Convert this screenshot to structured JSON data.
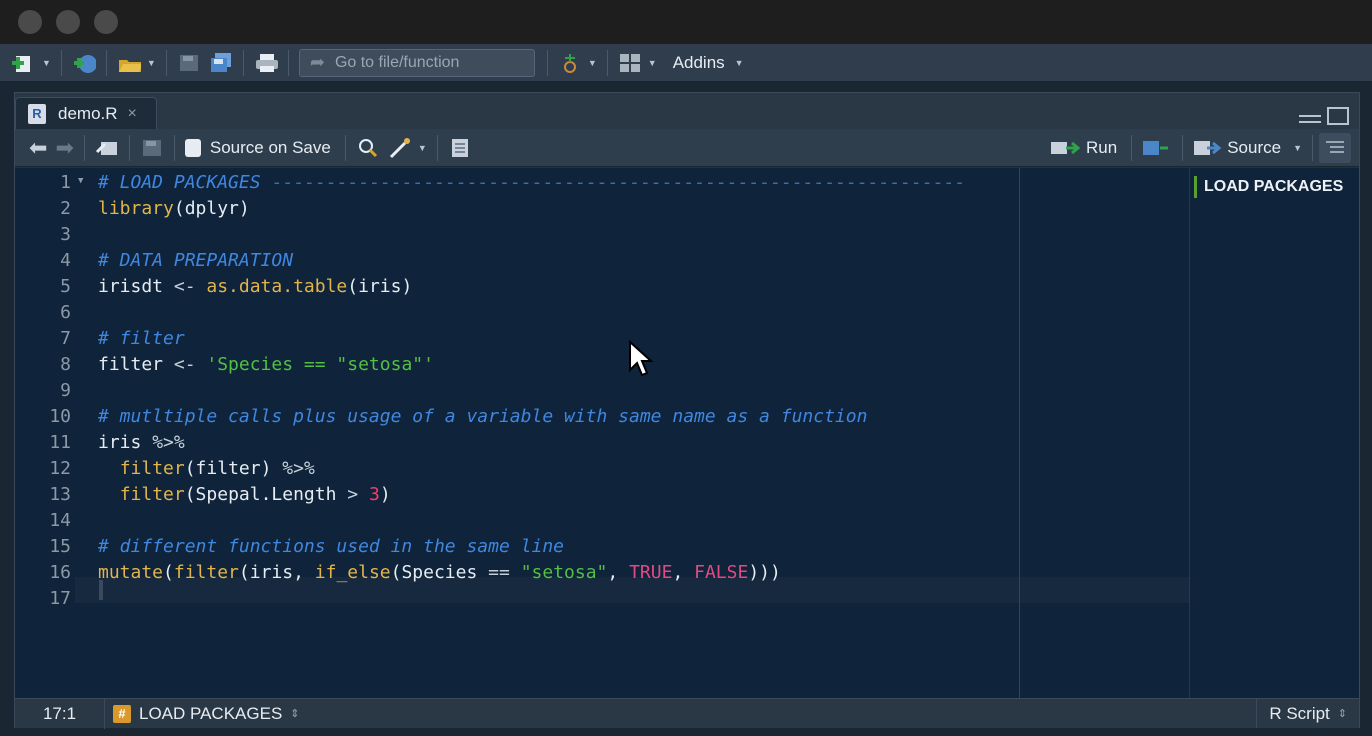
{
  "window": {
    "toolbar": {
      "goto_placeholder": "Go to file/function",
      "addins_label": "Addins"
    }
  },
  "tab": {
    "filename": "demo.R",
    "r_icon_letter": "R",
    "close_glyph": "×"
  },
  "editor_toolbar": {
    "source_on_save_label": "Source on Save",
    "run_label": "Run",
    "source_label": "Source"
  },
  "editor": {
    "line_numbers": [
      "1",
      "2",
      "3",
      "4",
      "5",
      "6",
      "7",
      "8",
      "9",
      "10",
      "11",
      "12",
      "13",
      "14",
      "15",
      "16",
      "17"
    ],
    "lines": [
      [
        {
          "t": "# LOAD PACKAGES ",
          "c": "c-com"
        },
        {
          "t": "----------------------------------------------------------------",
          "c": "c-dash"
        }
      ],
      [
        {
          "t": "library",
          "c": "c-fn"
        },
        {
          "t": "(dplyr)",
          "c": "c-id"
        }
      ],
      [],
      [
        {
          "t": "# DATA PREPARATION",
          "c": "c-com"
        }
      ],
      [
        {
          "t": "irisdt ",
          "c": "c-id"
        },
        {
          "t": "<- ",
          "c": "c-op"
        },
        {
          "t": "as.data.table",
          "c": "c-fn"
        },
        {
          "t": "(iris)",
          "c": "c-id"
        }
      ],
      [],
      [
        {
          "t": "# filter",
          "c": "c-com"
        }
      ],
      [
        {
          "t": "filter ",
          "c": "c-id"
        },
        {
          "t": "<- ",
          "c": "c-op"
        },
        {
          "t": "'Species == \"setosa\"'",
          "c": "c-str"
        }
      ],
      [],
      [
        {
          "t": "# mutltiple calls plus usage of a variable with same name as a function",
          "c": "c-com"
        }
      ],
      [
        {
          "t": "iris ",
          "c": "c-id"
        },
        {
          "t": "%>%",
          "c": "c-op"
        }
      ],
      [
        {
          "t": "  ",
          "c": "c-id"
        },
        {
          "t": "filter",
          "c": "c-fn"
        },
        {
          "t": "(filter) ",
          "c": "c-id"
        },
        {
          "t": "%>%",
          "c": "c-op"
        }
      ],
      [
        {
          "t": "  ",
          "c": "c-id"
        },
        {
          "t": "filter",
          "c": "c-fn"
        },
        {
          "t": "(Spepal.Length ",
          "c": "c-id"
        },
        {
          "t": "> ",
          "c": "c-op"
        },
        {
          "t": "3",
          "c": "c-num"
        },
        {
          "t": ")",
          "c": "c-id"
        }
      ],
      [],
      [
        {
          "t": "# different functions used in the same line",
          "c": "c-com"
        }
      ],
      [
        {
          "t": "mutate",
          "c": "c-fn"
        },
        {
          "t": "(",
          "c": "c-id"
        },
        {
          "t": "filter",
          "c": "c-fn"
        },
        {
          "t": "(iris, ",
          "c": "c-id"
        },
        {
          "t": "if_else",
          "c": "c-fn"
        },
        {
          "t": "(Species ",
          "c": "c-id"
        },
        {
          "t": "== ",
          "c": "c-op"
        },
        {
          "t": "\"setosa\"",
          "c": "c-str"
        },
        {
          "t": ", ",
          "c": "c-id"
        },
        {
          "t": "TRUE",
          "c": "c-kw"
        },
        {
          "t": ", ",
          "c": "c-id"
        },
        {
          "t": "FALSE",
          "c": "c-kw"
        },
        {
          "t": ")))",
          "c": "c-id"
        }
      ],
      []
    ]
  },
  "outline": {
    "items": [
      "LOAD PACKAGES"
    ]
  },
  "statusbar": {
    "cursor_position": "17:1",
    "section_icon": "#",
    "section_label": "LOAD PACKAGES",
    "file_type": "R Script"
  },
  "colors": {
    "editor_bg": "#0f233a",
    "comment": "#3f87e0",
    "function": "#e1b54a",
    "string": "#52c041",
    "number": "#ef3f6c"
  }
}
